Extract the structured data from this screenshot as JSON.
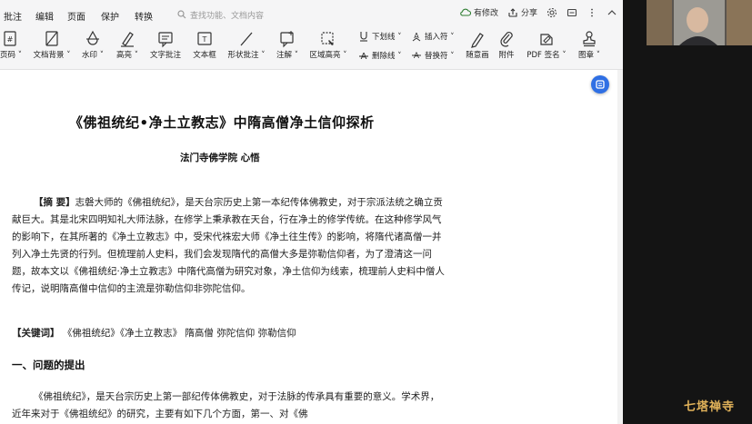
{
  "menu": {
    "items": [
      "批注",
      "编辑",
      "页面",
      "保护",
      "转换"
    ],
    "search_placeholder": "查找功能、文档内容",
    "modified_label": "有修改",
    "share_label": "分享"
  },
  "toolbar": {
    "tools": [
      {
        "label": "页码 ˅",
        "icon": "page-number-icon"
      },
      {
        "label": "文档背景 ˅",
        "icon": "document-background-icon"
      },
      {
        "label": "水印 ˅",
        "icon": "watermark-icon"
      },
      {
        "label": "高亮 ˅",
        "icon": "highlight-icon"
      },
      {
        "label": "文字批注",
        "icon": "text-comment-icon"
      },
      {
        "label": "文本框",
        "icon": "textbox-icon"
      },
      {
        "label": "形状批注 ˅",
        "icon": "shape-comment-icon"
      },
      {
        "label": "注解 ˅",
        "icon": "annotation-icon"
      },
      {
        "label": "区域高亮 ˅",
        "icon": "area-highlight-icon"
      }
    ],
    "underline_label": "下划线 ˅",
    "strikethrough_label": "删除线 ˅",
    "insert_char_label": "插入符 ˅",
    "replace_char_label": "替换符 ˅",
    "tools_right": [
      {
        "label": "随意画",
        "icon": "freehand-draw-icon"
      },
      {
        "label": "附件",
        "icon": "attachment-icon"
      },
      {
        "label": "PDF 签名 ˅",
        "icon": "pdf-signature-icon"
      },
      {
        "label": "图章 ˅",
        "icon": "stamp-icon"
      }
    ]
  },
  "document": {
    "title": "《佛祖统纪•净土立教志》中隋高僧净土信仰探析",
    "author": "法门寺佛学院  心悟",
    "abstract_label": "【摘 要】",
    "abstract_text": "志磐大师的《佛祖统纪》，是天台宗历史上第一本纪传体佛教史，对于宗派法统之确立贡献巨大。其是北宋四明知礼大师法脉，在修学上秉承教在天台，行在净土的修学传统。在这种修学风气的影响下，在其所著的《净土立教志》中，受宋代袾宏大师《净土往生传》的影响，将隋代诸高僧一并列入净土先贤的行列。但梳理前人史料，我们会发现隋代的高僧大多是弥勒信仰者，为了澄清这一问题，故本文以《佛祖统纪·净土立教志》中隋代高僧为研究对象，净土信仰为线索，梳理前人史料中僧人传记，说明隋高僧中信仰的主流是弥勒信仰非弥陀信仰。",
    "keywords_label": "【关键词】",
    "keywords_text": "《佛祖统纪》《净土立教志》 隋高僧 弥陀信仰 弥勒信仰",
    "section_heading": "一、问题的提出",
    "body_text": "《佛祖统纪》，是天台宗历史上第一部纪传体佛教史，对于法脉的传承具有重要的意义。学术界，近年来对于《佛祖统纪》的研究，主要有如下几个方面，第一、对《佛"
  },
  "video": {
    "watermark": "七塔禅寺"
  }
}
